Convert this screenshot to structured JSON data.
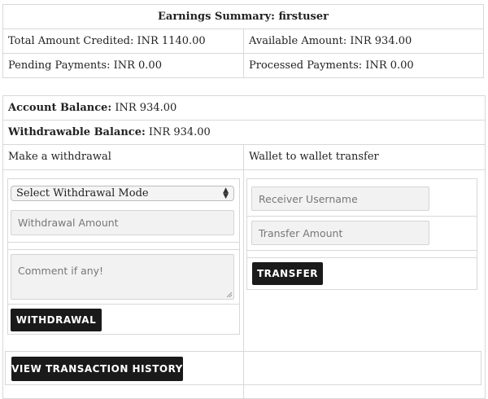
{
  "summary": {
    "title": "Earnings Summary: firstuser",
    "total_credited": "Total Amount Credited: INR 1140.00",
    "available": "Available Amount: INR 934.00",
    "pending": "Pending Payments: INR 0.00",
    "processed": "Processed Payments: INR 0.00"
  },
  "account": {
    "balance_label": "Account Balance:",
    "balance_value": " INR 934.00",
    "withdrawable_label": "Withdrawable Balance:",
    "withdrawable_value": " INR 934.00"
  },
  "withdraw": {
    "heading": "Make a withdrawal",
    "mode_selected": "Select Withdrawal Mode",
    "amount_placeholder": "Withdrawal Amount",
    "comment_placeholder": "Comment if any!",
    "button": "WITHDRAWAL"
  },
  "transfer": {
    "heading": "Wallet to wallet transfer",
    "receiver_placeholder": "Receiver Username",
    "amount_placeholder": "Transfer Amount",
    "button": "TRANSFER"
  },
  "history_button": "VIEW TRANSACTION HISTORY",
  "colors": {
    "button_bg": "#1a1a1a",
    "border": "#d8d8d8",
    "field_bg": "#f2f2f2"
  }
}
